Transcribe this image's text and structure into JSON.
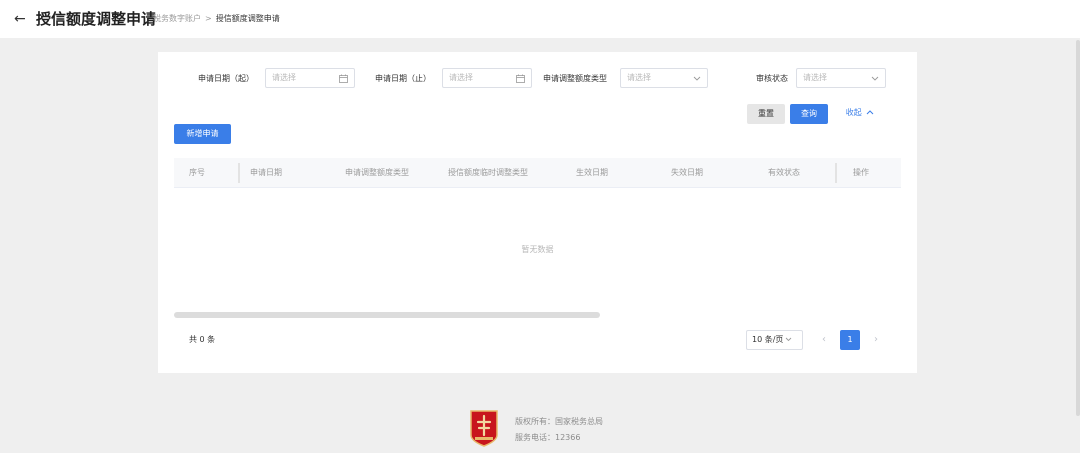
{
  "header": {
    "back_icon": "←",
    "title": "授信额度调整申请",
    "breadcrumb": {
      "parent": "税务数字账户",
      "separator": ">",
      "current": "授信额度调整申请"
    }
  },
  "filters": {
    "start_date": {
      "label": "申请日期（起）",
      "placeholder": "请选择",
      "icon": "calendar-icon"
    },
    "end_date": {
      "label": "申请日期（止）",
      "placeholder": "请选择",
      "icon": "calendar-icon"
    },
    "adjust_type": {
      "label": "申请调整额度类型",
      "placeholder": "请选择",
      "icon": "chevron-down-icon"
    },
    "audit_status": {
      "label": "审核状态",
      "placeholder": "请选择",
      "icon": "chevron-down-icon"
    }
  },
  "actions": {
    "reset_label": "重置",
    "query_label": "查询",
    "collapse_label": "收起",
    "add_label": "新增申请"
  },
  "table": {
    "columns": [
      "序号",
      "申请日期",
      "申请调整额度类型",
      "授信额度临时调整类型",
      "生效日期",
      "失效日期",
      "有效状态",
      "操作"
    ],
    "empty_text": "暂无数据"
  },
  "pagination": {
    "total_text": "共 0 条",
    "page_size": "10 条/页",
    "current_page": "1",
    "prev_icon": "‹",
    "next_icon": "›"
  },
  "footer": {
    "copyright": "版权所有：国家税务总局",
    "phone": "服务电话：12366"
  },
  "colors": {
    "primary": "#3a7ee8",
    "background": "#efefef",
    "logo_red": "#c8161d",
    "logo_gold": "#e8b86a"
  }
}
